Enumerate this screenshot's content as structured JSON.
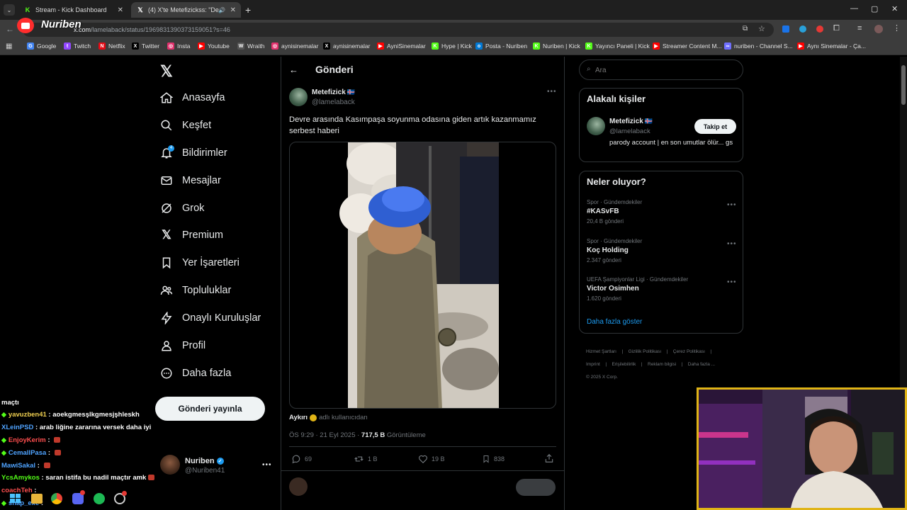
{
  "browser": {
    "tabs": [
      {
        "title": "Stream - Kick Dashboard",
        "icon": "kick-icon"
      },
      {
        "title": "(4) X'te Metefizickss: \"Devre",
        "icon": "x-icon"
      }
    ],
    "url_domain": "x.com",
    "url_path": "/lamelaback/status/1969831390373159051?s=46",
    "overlay_logo": "Nuriben",
    "bookmarks": [
      {
        "label": "Google",
        "color": "#4285f4",
        "glyph": "G"
      },
      {
        "label": "Twitch",
        "color": "#9146ff",
        "glyph": "t"
      },
      {
        "label": "Netflix",
        "color": "#e50914",
        "glyph": "N"
      },
      {
        "label": "Twitter",
        "color": "#000000",
        "glyph": "X"
      },
      {
        "label": "Insta",
        "color": "#e1306c",
        "glyph": "◎"
      },
      {
        "label": "Youtube",
        "color": "#ff0000",
        "glyph": "▶"
      },
      {
        "label": "Wraith",
        "color": "#555555",
        "glyph": "W"
      },
      {
        "label": "aynisinemalar",
        "color": "#e1306c",
        "glyph": "◎"
      },
      {
        "label": "aynisinemalar",
        "color": "#000000",
        "glyph": "X"
      },
      {
        "label": "AyniSinemalar",
        "color": "#ff0000",
        "glyph": "▶"
      },
      {
        "label": "Hype | Kick",
        "color": "#53fc18",
        "glyph": "K"
      },
      {
        "label": "Posta - Nuriben",
        "color": "#0078d4",
        "glyph": "o"
      },
      {
        "label": "Nuriben | Kick",
        "color": "#53fc18",
        "glyph": "K"
      },
      {
        "label": "Yayıncı Paneli | Kick",
        "color": "#53fc18",
        "glyph": "K"
      },
      {
        "label": "Streamer Content M...",
        "color": "#ff0000",
        "glyph": "▶"
      },
      {
        "label": "nuriben - Channel S...",
        "color": "#6f6fff",
        "glyph": "∞"
      },
      {
        "label": "Aynı Sinemalar - Ça...",
        "color": "#ff0000",
        "glyph": "▶"
      }
    ]
  },
  "sidebar": {
    "items": [
      {
        "label": "Anasayfa",
        "icon": "home-icon"
      },
      {
        "label": "Keşfet",
        "icon": "search-icon"
      },
      {
        "label": "Bildirimler",
        "icon": "bell-icon",
        "badge": "4"
      },
      {
        "label": "Mesajlar",
        "icon": "mail-icon"
      },
      {
        "label": "Grok",
        "icon": "grok-icon"
      },
      {
        "label": "Premium",
        "icon": "x-logo-icon"
      },
      {
        "label": "Yer İşaretleri",
        "icon": "bookmark-icon"
      },
      {
        "label": "Topluluklar",
        "icon": "communities-icon"
      },
      {
        "label": "Onaylı Kuruluşlar",
        "icon": "lightning-icon"
      },
      {
        "label": "Profil",
        "icon": "person-icon"
      },
      {
        "label": "Daha fazla",
        "icon": "more-circle-icon"
      }
    ],
    "post_button": "Gönderi yayınla",
    "account": {
      "name": "Nuriben",
      "handle": "@Nuriben41"
    }
  },
  "post": {
    "header": "Gönderi",
    "author": {
      "name": "Metefizick",
      "flag": "🇮🇸",
      "handle": "@lamelaback"
    },
    "text": "Devre arasında Kasımpaşa soyunma odasına giden artık kazanmamız serbest haberi",
    "source_name": "Aykırı",
    "source_suffix": "adlı kullanıcıdan",
    "time": "ÖS 9:29 · 21 Eyl 2025 · ",
    "views": "717,5 B",
    "views_label": " Görüntüleme",
    "stats": {
      "replies": "69",
      "reposts": "1 B",
      "likes": "19 B",
      "bookmarks": "838"
    }
  },
  "right": {
    "search_placeholder": "Ara",
    "related": {
      "title": "Alakalı kişiler",
      "name": "Metefizick",
      "flag": "🇮🇸",
      "handle": "@lamelaback",
      "follow": "Takip et",
      "bio": "parody account | en son umutlar ölür... gs"
    },
    "trends": {
      "title": "Neler oluyor?",
      "items": [
        {
          "meta": "Spor · Gündemdekiler",
          "name": "#KASvFB",
          "count": "20,4 B gönderi"
        },
        {
          "meta": "Spor · Gündemdekiler",
          "name": "Koç Holding",
          "count": "2.347 gönderi"
        },
        {
          "meta": "UEFA Şampiyonlar Ligi · Gündemdekiler",
          "name": "Victor Osimhen",
          "count": "1.620 gönderi"
        }
      ],
      "more": "Daha fazla göster"
    },
    "footer": [
      "Hizmet Şartları",
      "|",
      "Gizlilik Politikası",
      "|",
      "Çerez Politikası",
      "|",
      "Imprint",
      "|",
      "Erişilebilirlik",
      "|",
      "Reklam bilgisi",
      "|",
      "Daha fazla ...",
      "© 2025 X Corp."
    ]
  },
  "chat": [
    {
      "user": "",
      "message": "maçtı",
      "color": "#ffffff",
      "gem": false,
      "emote": false
    },
    {
      "user": "yavuzben41",
      "message": " : aoekgmesşlkgmesjşhleskh",
      "color": "#f0d050",
      "gem": true,
      "emote": false
    },
    {
      "user": "XLeinPSD",
      "message": " : arab liğine zararına versek daha iyi",
      "color": "#4fa3ff",
      "gem": false,
      "emote": false
    },
    {
      "user": "EnjoyKerim",
      "message": " : ",
      "color": "#ff4f4f",
      "gem": true,
      "emote": true
    },
    {
      "user": "CemallPasa",
      "message": " : ",
      "color": "#4fa3ff",
      "gem": true,
      "emote": true
    },
    {
      "user": "MawiSakal",
      "message": " : ",
      "color": "#4fa3ff",
      "gem": false,
      "emote": true
    },
    {
      "user": "YcsAmykos",
      "message": " : saran istifa bu nadil maçtır amk",
      "color": "#53fc18",
      "gem": false,
      "emote": true
    },
    {
      "user": "coachTeh",
      "message": " : ",
      "color": "#ff4f4f",
      "gem": false,
      "emote": false
    },
    {
      "user": "snap_exe",
      "message": " : ",
      "color": "#4fa3ff",
      "gem": true,
      "emote": false
    }
  ]
}
